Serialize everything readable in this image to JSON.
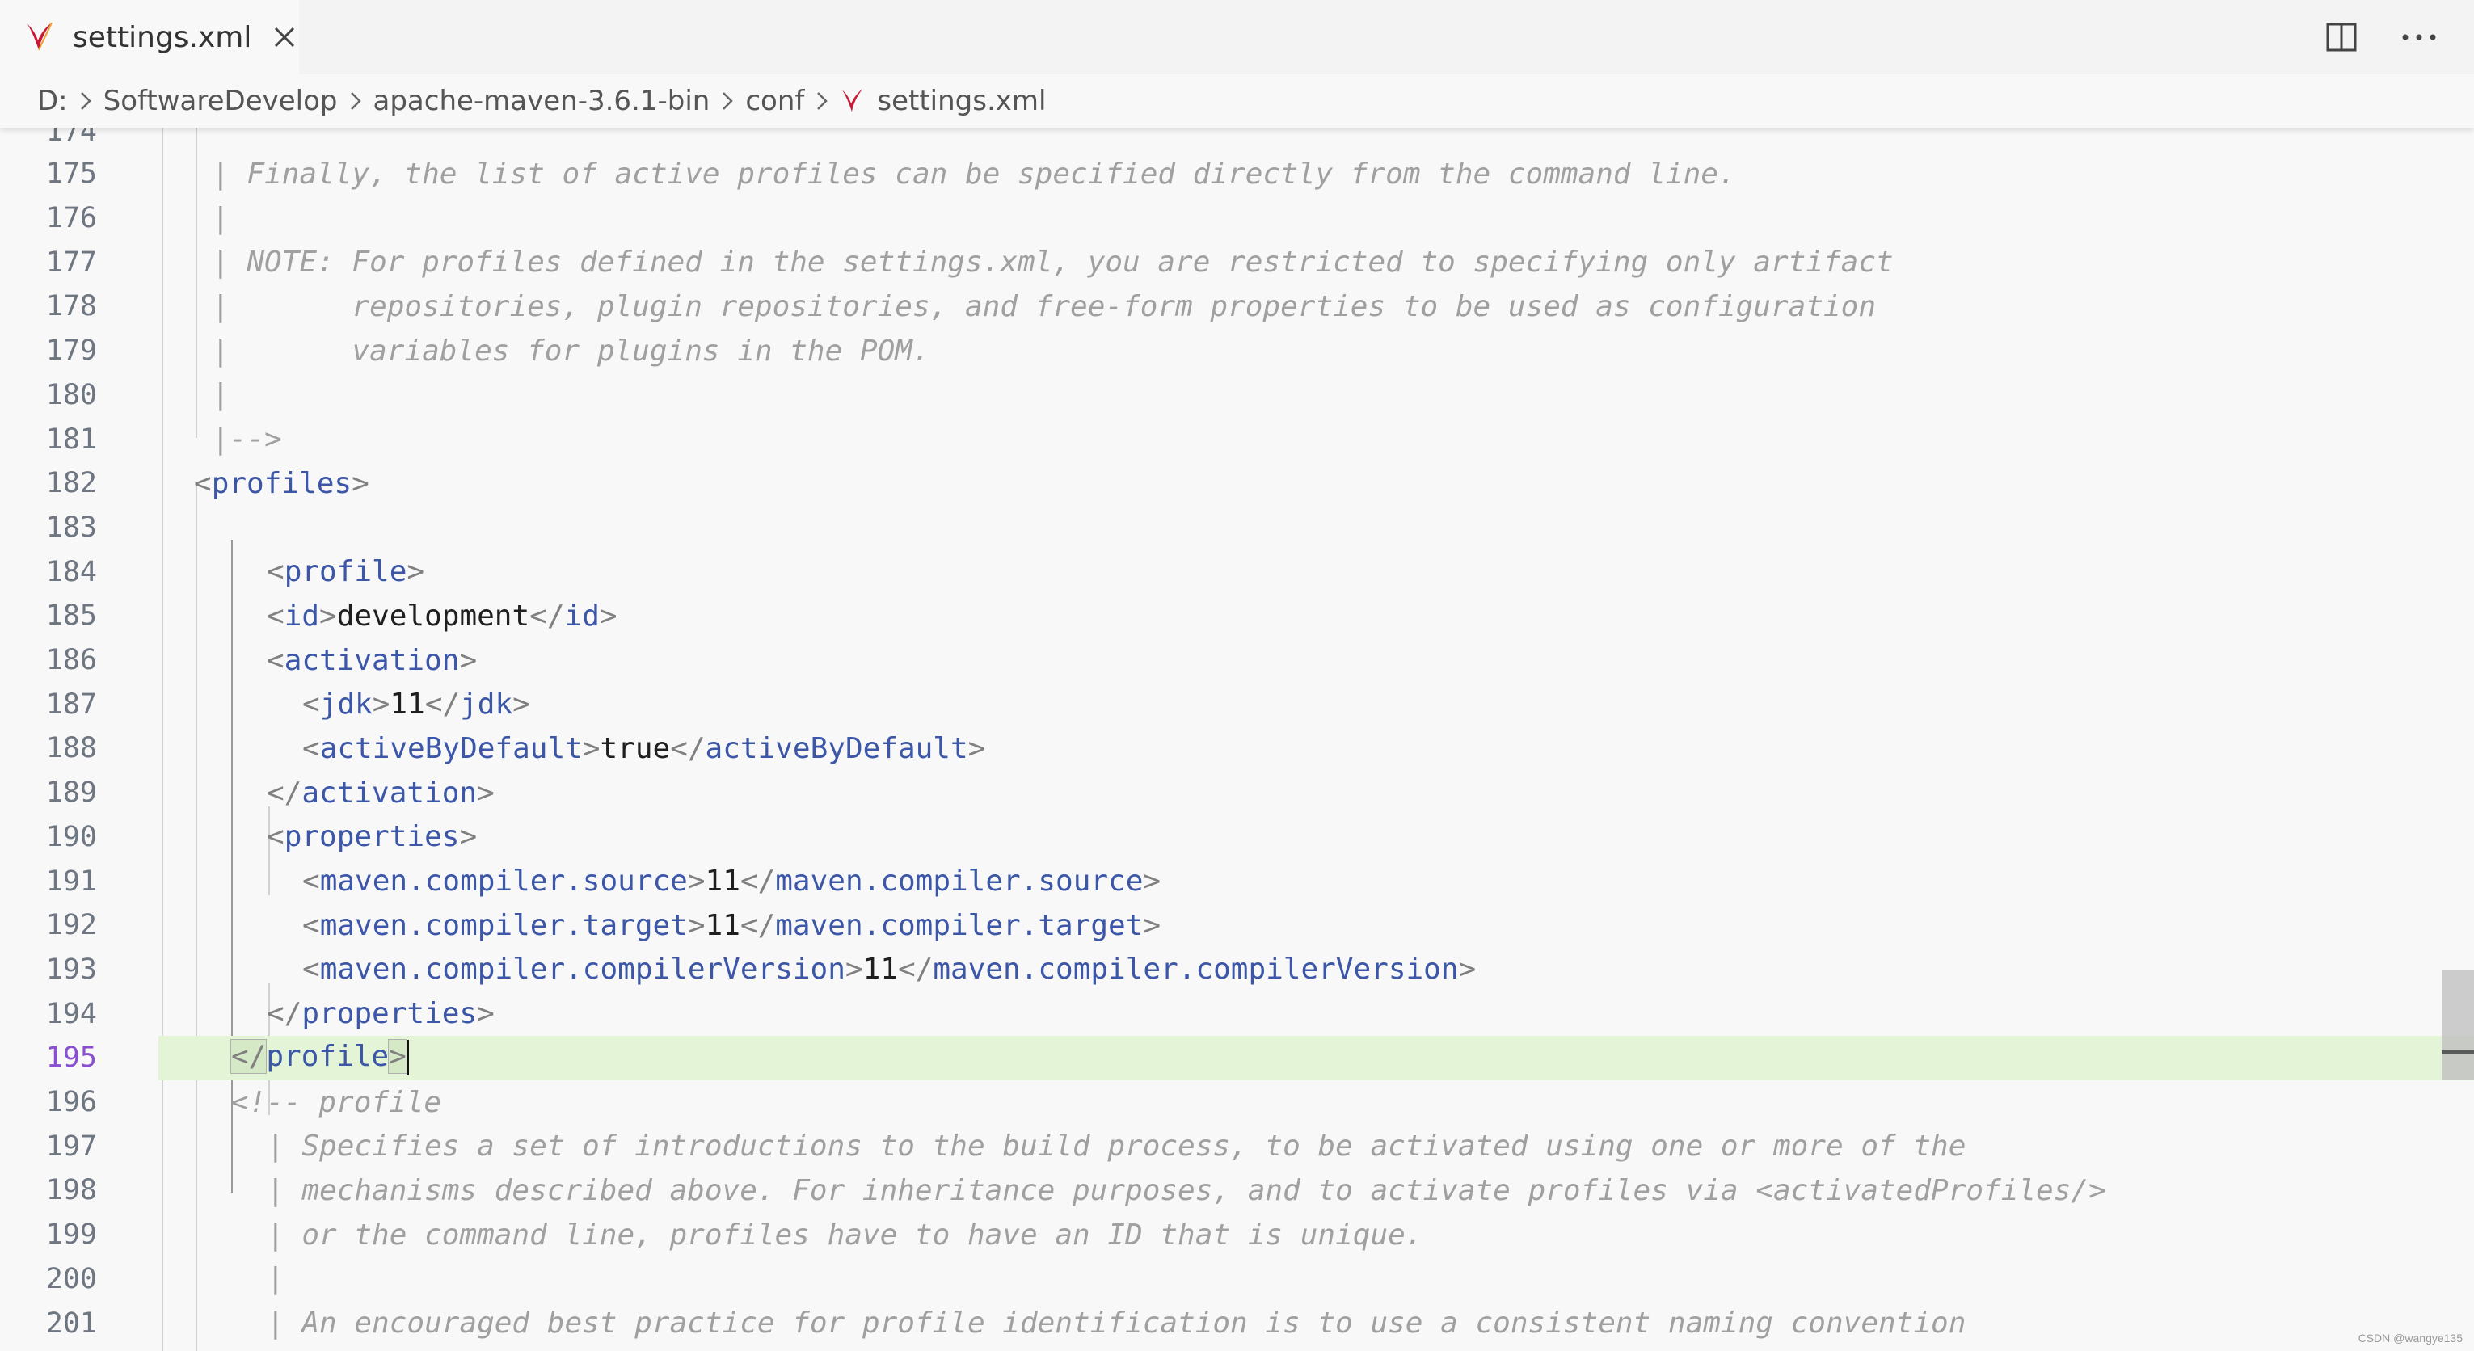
{
  "tab": {
    "label": "settings.xml",
    "close_icon": "close-icon",
    "file_icon": "maven-feather-icon"
  },
  "actions": {
    "split_icon": "split-editor-icon",
    "more_icon": "more-actions-icon"
  },
  "breadcrumb": {
    "items": [
      "D:",
      "SoftwareDevelop",
      "apache-maven-3.6.1-bin",
      "conf",
      "settings.xml"
    ],
    "separator_icon": "chevron-right-icon"
  },
  "colors": {
    "comment": "#a0a0a0",
    "tag": "#3c57a8",
    "current_line": "#e3f4d7",
    "current_line_number": "#8a4fd0"
  },
  "editor": {
    "lines": [
      {
        "num": "175",
        "text": "| Finally, the list of active profiles can be specified directly from the command line."
      },
      {
        "num": "176",
        "text": "|"
      },
      {
        "num": "177",
        "text": "| NOTE: For profiles defined in the settings.xml, you are restricted to specifying only artifact"
      },
      {
        "num": "178",
        "text": "|       repositories, plugin repositories, and free-form properties to be used as configuration"
      },
      {
        "num": "179",
        "text": "|       variables for plugins in the POM."
      },
      {
        "num": "180",
        "text": "|"
      },
      {
        "num": "181",
        "text": "|-->"
      },
      {
        "num": "182",
        "tag": "profiles"
      },
      {
        "num": "183"
      },
      {
        "num": "184",
        "tag": "profile"
      },
      {
        "num": "185",
        "tag": "id",
        "value": "development",
        "close": "id"
      },
      {
        "num": "186",
        "tag": "activation"
      },
      {
        "num": "187",
        "tag": "jdk",
        "value": "11",
        "close": "jdk"
      },
      {
        "num": "188",
        "tag": "activeByDefault",
        "value": "true",
        "close": "activeByDefault"
      },
      {
        "num": "189",
        "close": "activation"
      },
      {
        "num": "190",
        "tag": "properties"
      },
      {
        "num": "191",
        "tag": "maven.compiler.source",
        "value": "11",
        "close": "maven.compiler.source"
      },
      {
        "num": "192",
        "tag": "maven.compiler.target",
        "value": "11",
        "close": "maven.compiler.target"
      },
      {
        "num": "193",
        "tag": "maven.compiler.compilerVersion",
        "value": "11",
        "close": "maven.compiler.compilerVersion"
      },
      {
        "num": "194",
        "close": "properties"
      },
      {
        "num": "195",
        "close": "profile"
      },
      {
        "num": "196",
        "text": "<!-- profile"
      },
      {
        "num": "197",
        "text": "| Specifies a set of introductions to the build process, to be activated using one or more of the"
      },
      {
        "num": "198",
        "text": "| mechanisms described above. For inheritance purposes, and to activate profiles via <activatedProfiles/>"
      },
      {
        "num": "199",
        "text": "| or the command line, profiles have to have an ID that is unique."
      },
      {
        "num": "200",
        "text": "|"
      },
      {
        "num": "201",
        "text": "| An encouraged best practice for profile identification is to use a consistent naming convention"
      }
    ]
  },
  "watermark": "CSDN @wangye135"
}
